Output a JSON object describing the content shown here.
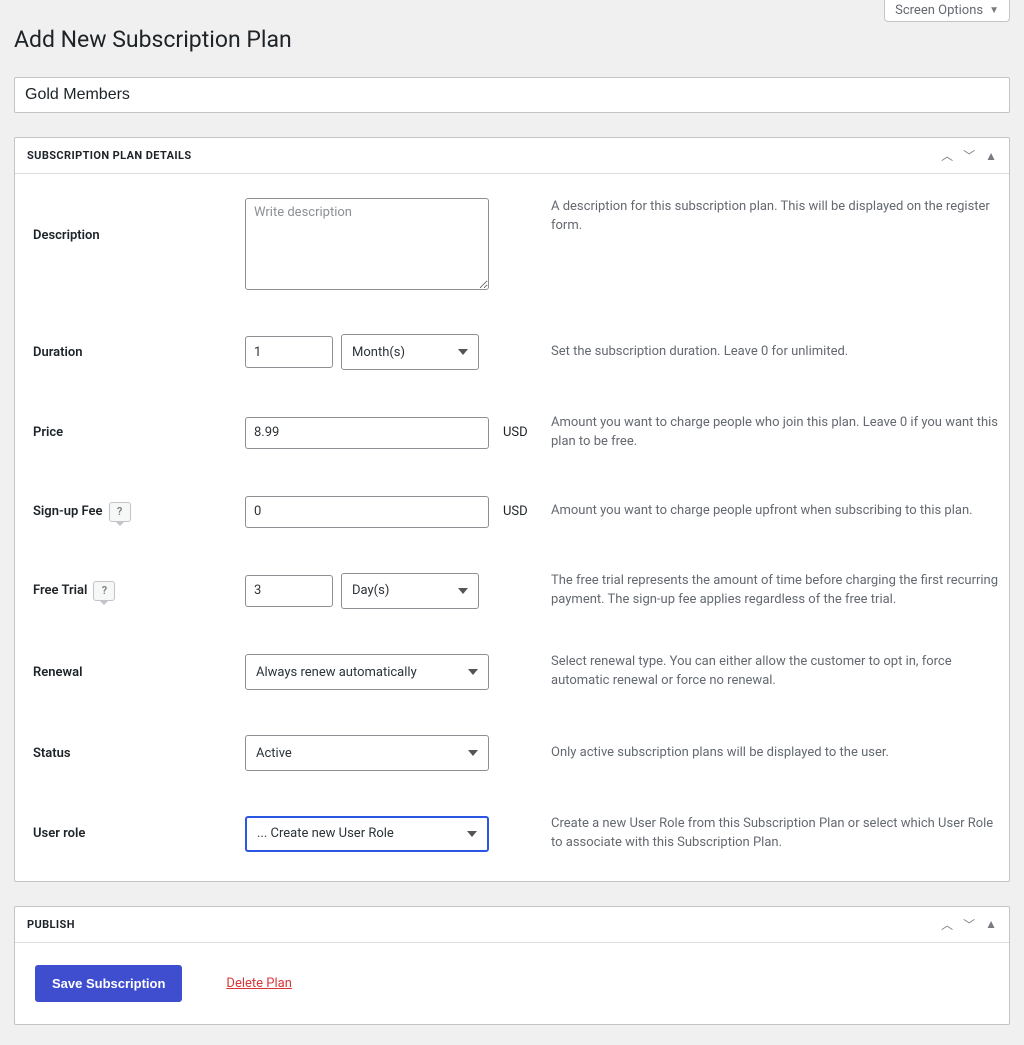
{
  "screen_options_label": "Screen Options",
  "page_title": "Add New Subscription Plan",
  "title_value": "Gold Members",
  "details": {
    "panel_title": "SUBSCRIPTION PLAN DETAILS",
    "description": {
      "label": "Description",
      "placeholder": "Write description",
      "value": "",
      "hint": "A description for this subscription plan. This will be displayed on the register form."
    },
    "duration": {
      "label": "Duration",
      "value": "1",
      "unit": "Month(s)",
      "hint": "Set the subscription duration. Leave 0 for unlimited."
    },
    "price": {
      "label": "Price",
      "value": "8.99",
      "currency": "USD",
      "hint": "Amount you want to charge people who join this plan. Leave 0 if you want this plan to be free."
    },
    "signup_fee": {
      "label": "Sign-up Fee",
      "value": "0",
      "currency": "USD",
      "hint": "Amount you want to charge people upfront when subscribing to this plan."
    },
    "free_trial": {
      "label": "Free Trial",
      "value": "3",
      "unit": "Day(s)",
      "hint": "The free trial represents the amount of time before charging the first recurring payment. The sign-up fee applies regardless of the free trial."
    },
    "renewal": {
      "label": "Renewal",
      "value": "Always renew automatically",
      "hint": "Select renewal type. You can either allow the customer to opt in, force automatic renewal or force no renewal."
    },
    "status": {
      "label": "Status",
      "value": "Active",
      "hint": "Only active subscription plans will be displayed to the user."
    },
    "user_role": {
      "label": "User role",
      "value": "... Create new User Role",
      "hint": "Create a new User Role from this Subscription Plan or select which User Role to associate with this Subscription Plan."
    }
  },
  "publish": {
    "panel_title": "PUBLISH",
    "save_label": "Save Subscription",
    "delete_label": "Delete Plan"
  }
}
